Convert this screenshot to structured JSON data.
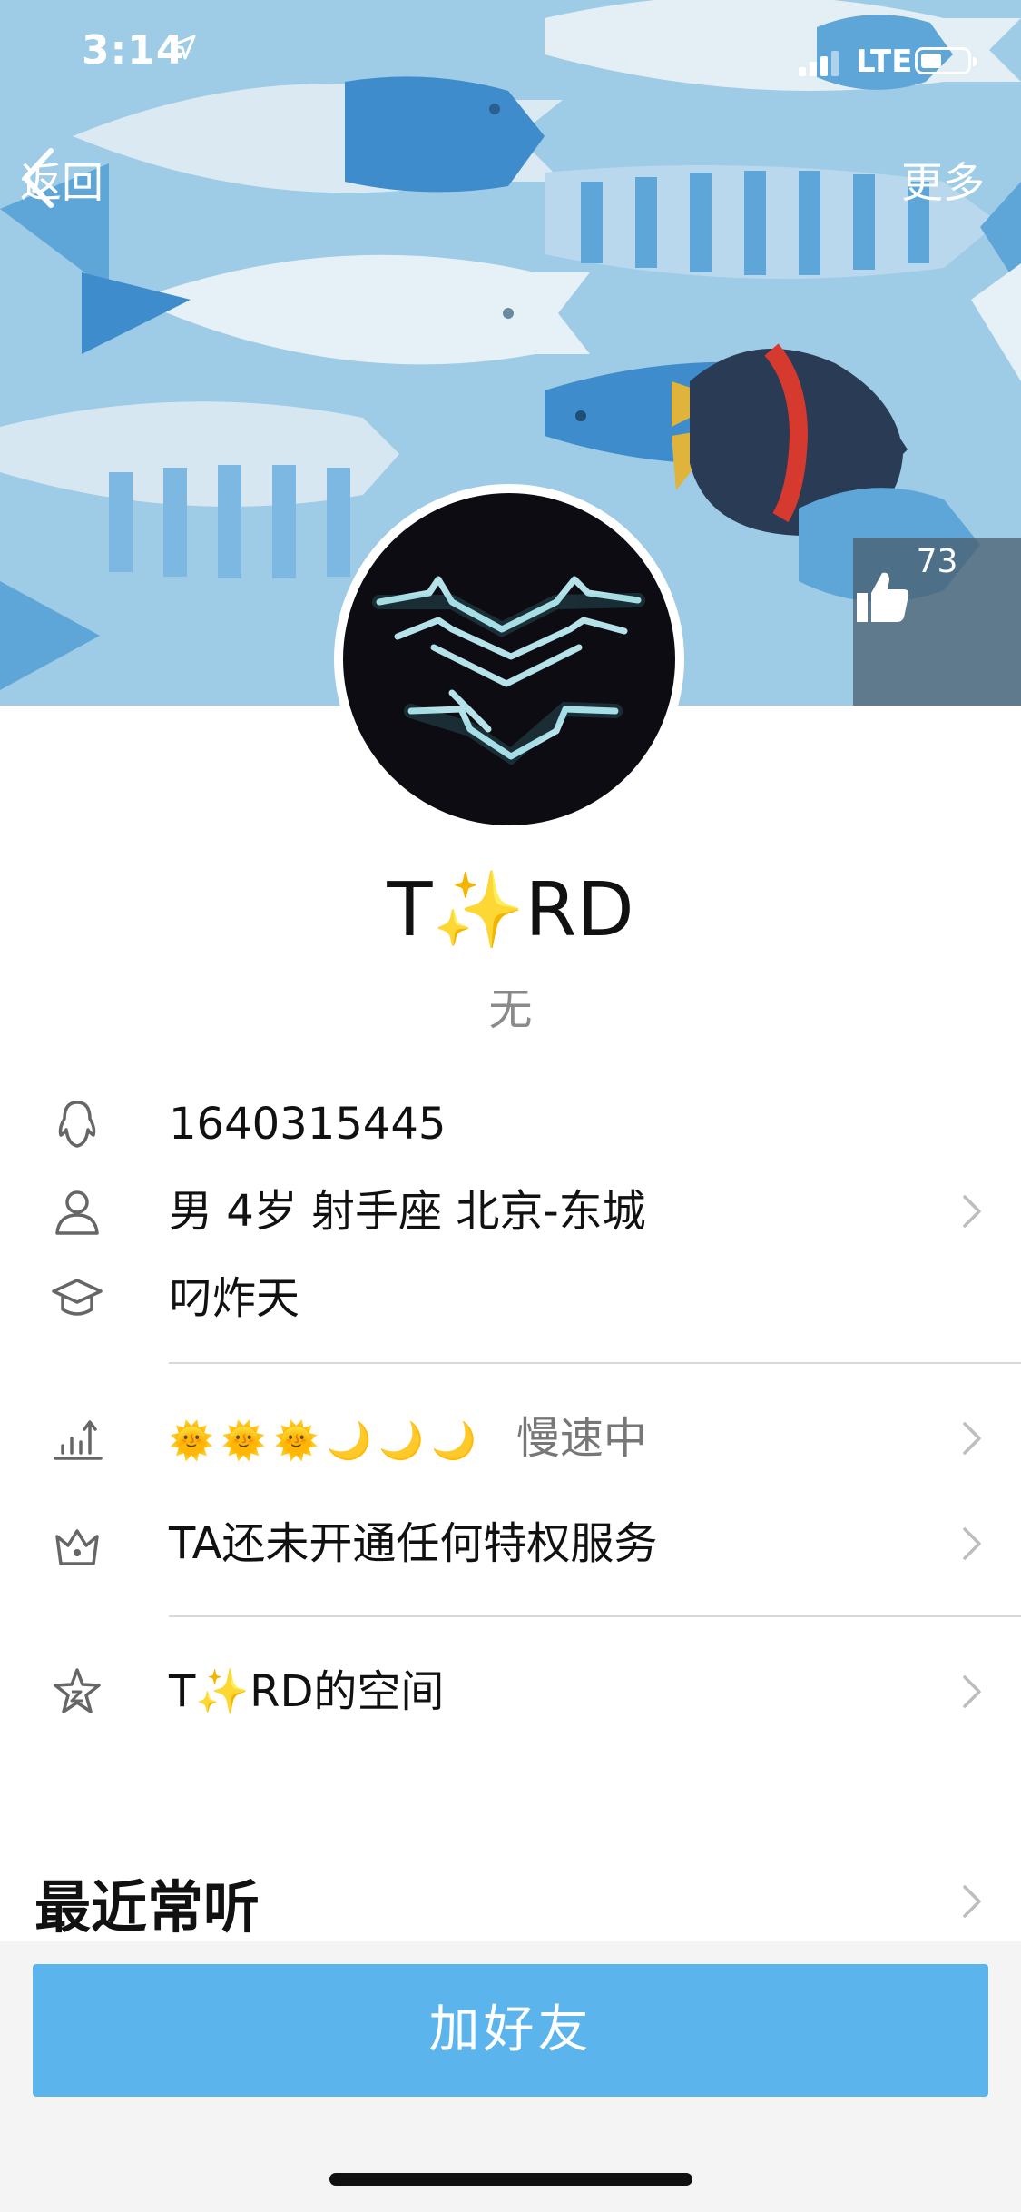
{
  "status_bar": {
    "time": "3:14",
    "network": "LTE"
  },
  "nav": {
    "back_label": "返回",
    "more_label": "更多"
  },
  "like": {
    "count": "73"
  },
  "profile": {
    "nickname": "T✨RD",
    "signature": "无",
    "qq_number": "1640315445",
    "basic_info": "男 4岁 射手座 北京-东城",
    "school": "叼炸天",
    "level_status": "慢速中",
    "level_badges": [
      "🌞",
      "🌞",
      "🌞",
      "🌙",
      "🌙",
      "🌙"
    ],
    "privilege": "TA还未开通任何特权服务",
    "space": "T✨RD的空间"
  },
  "sections": {
    "recent_listening": "最近常听"
  },
  "actions": {
    "add_friend": "加好友"
  },
  "colors": {
    "cover_bg": "#9ecbe6",
    "button_blue": "#5bb4ec",
    "text_gray": "#8a8a8a",
    "divider": "#d9d9d9"
  },
  "icons": {
    "qq": "penguin-outline-icon",
    "person": "person-outline-icon",
    "school": "graduation-cap-icon",
    "level": "level-chart-icon",
    "privilege": "crown-icon",
    "space": "star-icon",
    "chevron": "chevron-right-icon",
    "like": "thumbs-up-icon",
    "back": "chevron-left-icon"
  }
}
